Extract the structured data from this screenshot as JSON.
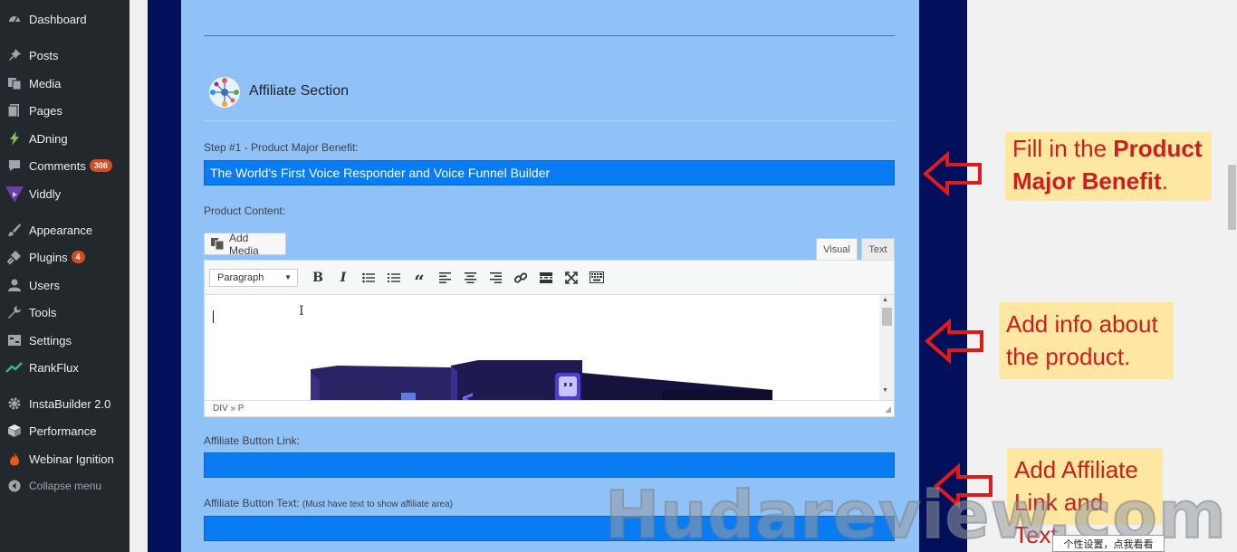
{
  "sidebar": {
    "items": [
      {
        "label": "Dashboard",
        "icon": "dashboard-icon"
      },
      {
        "label": "Posts",
        "icon": "pin-icon"
      },
      {
        "label": "Media",
        "icon": "media-icon"
      },
      {
        "label": "Pages",
        "icon": "page-icon"
      },
      {
        "label": "ADning",
        "icon": "lightning-icon"
      },
      {
        "label": "Comments",
        "icon": "comment-icon",
        "badge": "308"
      },
      {
        "label": "Viddly",
        "icon": "viddly-icon"
      },
      {
        "label": "Appearance",
        "icon": "brush-icon"
      },
      {
        "label": "Plugins",
        "icon": "plug-icon",
        "badge": "4"
      },
      {
        "label": "Users",
        "icon": "user-icon"
      },
      {
        "label": "Tools",
        "icon": "wrench-icon"
      },
      {
        "label": "Settings",
        "icon": "settings-icon"
      },
      {
        "label": "RankFlux",
        "icon": "chart-icon"
      },
      {
        "label": "InstaBuilder 2.0",
        "icon": "gear-icon"
      },
      {
        "label": "Performance",
        "icon": "cube-icon"
      },
      {
        "label": "Webinar Ignition",
        "icon": "flame-icon"
      },
      {
        "label": "Collapse menu",
        "icon": "collapse-icon"
      }
    ]
  },
  "section": {
    "title": "Affiliate Section"
  },
  "step1": {
    "label": "Step #1 - Product Major Benefit:",
    "value": "The World's First Voice Responder and Voice Funnel Builder"
  },
  "content": {
    "label": "Product Content:",
    "add_media": "Add Media",
    "tab_visual": "Visual",
    "tab_text": "Text",
    "format_select": "Paragraph",
    "status_path": "DIV » P"
  },
  "affiliate_link": {
    "label": "Affiliate Button Link:",
    "value": ""
  },
  "affiliate_text": {
    "label": "Affiliate Button Text:",
    "hint": "(Must have text to show affiliate area)",
    "value": ""
  },
  "annotations": {
    "note1_line1_prefix": "Fill in the ",
    "note1_line1_bold": "Product",
    "note1_line2_bold": "Major Benefit",
    "note1_line2_suffix": ".",
    "note2_line1": "Add info about",
    "note2_line2": "the product.",
    "note3_line1": "Add Affiliate",
    "note3_line2": "Link and Text."
  },
  "watermark": "Hudareview.com",
  "tooltip": "个性设置，点我看看",
  "colors": {
    "panel": "#90c2f8",
    "dark_band": "#020f5a",
    "input_blue": "#0a7cf3",
    "annotation_bg": "#fde7a1",
    "annotation_text": "#cf1d1d",
    "sidebar": "#23282d"
  }
}
